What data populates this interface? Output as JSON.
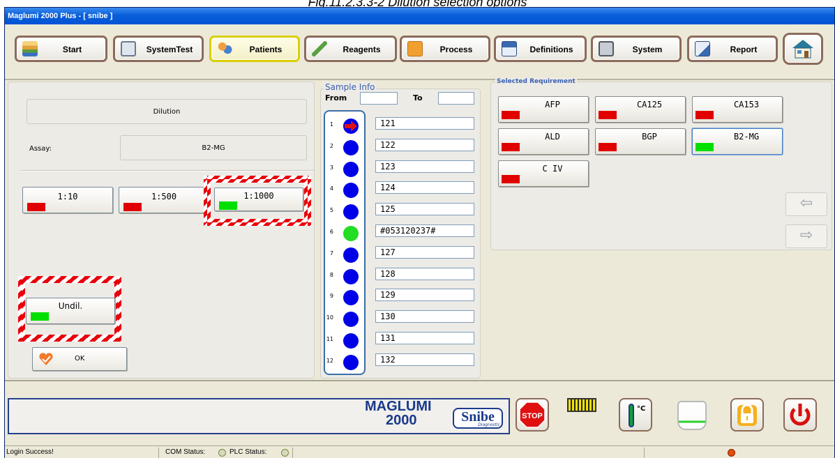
{
  "caption": "Fig.11.2.3.3-2 Dilution selection options",
  "window_title": "Maglumi 2000 Plus - [ snibe ]",
  "toolbar": [
    {
      "label": "Start",
      "icon": "start-icon"
    },
    {
      "label": "SystemTest",
      "icon": "system-test-icon"
    },
    {
      "label": "Patients",
      "icon": "patients-icon",
      "active": true
    },
    {
      "label": "Reagents",
      "icon": "reagents-icon"
    },
    {
      "label": "Process",
      "icon": "process-icon"
    },
    {
      "label": "Definitions",
      "icon": "definitions-icon"
    },
    {
      "label": "System",
      "icon": "system-icon"
    },
    {
      "label": "Report",
      "icon": "report-icon"
    }
  ],
  "dilution": {
    "title": "Dilution",
    "assay_label": "Assay:",
    "assay_value": "B2-MG",
    "options": [
      {
        "label": "1:10",
        "state": "red"
      },
      {
        "label": "1:500",
        "state": "red"
      },
      {
        "label": "1:1000",
        "state": "green",
        "highlighted": true
      }
    ],
    "undil": {
      "label": "Undil.",
      "state": "green",
      "highlighted": true
    },
    "ok_label": "OK"
  },
  "sample_info": {
    "title": "Sample Info",
    "from_label": "From",
    "to_label": "To",
    "from_value": "",
    "to_value": "",
    "slots": [
      {
        "n": "1",
        "id": "121",
        "state": "current"
      },
      {
        "n": "2",
        "id": "122",
        "state": "blue"
      },
      {
        "n": "3",
        "id": "123",
        "state": "blue"
      },
      {
        "n": "4",
        "id": "124",
        "state": "blue"
      },
      {
        "n": "5",
        "id": "125",
        "state": "blue"
      },
      {
        "n": "6",
        "id": "#053120237#",
        "state": "green"
      },
      {
        "n": "7",
        "id": "127",
        "state": "blue"
      },
      {
        "n": "8",
        "id": "128",
        "state": "blue"
      },
      {
        "n": "9",
        "id": "129",
        "state": "blue"
      },
      {
        "n": "10",
        "id": "130",
        "state": "blue"
      },
      {
        "n": "11",
        "id": "131",
        "state": "blue"
      },
      {
        "n": "12",
        "id": "132",
        "state": "blue"
      }
    ]
  },
  "requirements": {
    "title": "Selected Requirement",
    "items": [
      {
        "label": "AFP",
        "state": "red"
      },
      {
        "label": "CA125",
        "state": "red"
      },
      {
        "label": "CA153",
        "state": "red"
      },
      {
        "label": "ALD",
        "state": "red"
      },
      {
        "label": "BGP",
        "state": "red"
      },
      {
        "label": "B2-MG",
        "state": "green",
        "selected": true
      },
      {
        "label": "C IV",
        "state": "red"
      }
    ]
  },
  "bottom": {
    "logo_line1": "MAGLUMI",
    "logo_line2": "2000",
    "brand": "Snibe",
    "brand_sub": "Diagnostic",
    "stop_label": "STOP",
    "temp_unit": "°C"
  },
  "status": {
    "login": "Login Success!",
    "com_label": "COM Status:",
    "plc_label": "PLC Status:"
  },
  "colors": {
    "red": "#e00000",
    "green": "#00e000",
    "blue": "#0000e8"
  }
}
